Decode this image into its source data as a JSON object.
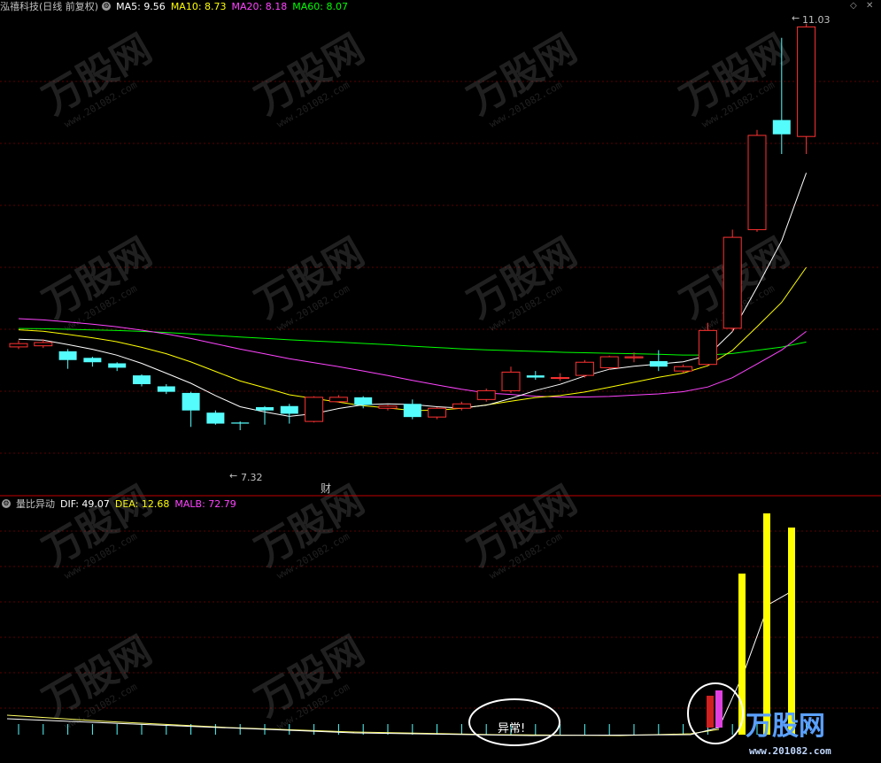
{
  "main_panel": {
    "title": "泓禧科技(日线 前复权)",
    "indicators": [
      {
        "label": "MA5",
        "value": "9.56",
        "color": "#ffffff"
      },
      {
        "label": "MA10",
        "value": "8.73",
        "color": "#ffff00"
      },
      {
        "label": "MA20",
        "value": "8.18",
        "color": "#ff44ff"
      },
      {
        "label": "MA60",
        "value": "8.07",
        "color": "#00ff00"
      }
    ],
    "high_label": "11.03",
    "low_label": "7.32",
    "finance_marker": "财",
    "corner_icons": [
      "diamond-icon",
      "close-icon"
    ]
  },
  "sub_panel": {
    "title": "量比异动",
    "indicators": [
      {
        "label": "DIF",
        "value": "49.07",
        "color": "#ffffff"
      },
      {
        "label": "DEA",
        "value": "12.68",
        "color": "#ffff00"
      },
      {
        "label": "MALB",
        "value": "72.79",
        "color": "#ff44ff"
      }
    ],
    "annotation": "异常!"
  },
  "watermark": {
    "brand": "万股网",
    "url": "www.201082.com"
  },
  "colors": {
    "up": "#ff3232",
    "down": "#54fcfc",
    "grid": "#5a0000",
    "divider": "#b00000"
  },
  "chart_data": {
    "type": "candlestick",
    "price_axis": [
      6.9,
      11.1
    ],
    "candles": [
      {
        "o": 8.08,
        "h": 8.14,
        "c": 8.11,
        "l": 8.06
      },
      {
        "o": 8.09,
        "h": 8.15,
        "c": 8.12,
        "l": 8.07
      },
      {
        "o": 8.04,
        "h": 8.06,
        "c": 7.96,
        "l": 7.88
      },
      {
        "o": 7.98,
        "h": 7.99,
        "c": 7.94,
        "l": 7.9
      },
      {
        "o": 7.93,
        "h": 7.94,
        "c": 7.89,
        "l": 7.86
      },
      {
        "o": 7.82,
        "h": 7.83,
        "c": 7.74,
        "l": 7.72
      },
      {
        "o": 7.72,
        "h": 7.74,
        "c": 7.67,
        "l": 7.65
      },
      {
        "o": 7.66,
        "h": 7.67,
        "c": 7.5,
        "l": 7.35
      },
      {
        "o": 7.48,
        "h": 7.5,
        "c": 7.38,
        "l": 7.37
      },
      {
        "o": 7.39,
        "h": 7.4,
        "c": 7.38,
        "l": 7.32
      },
      {
        "o": 7.53,
        "h": 7.54,
        "c": 7.5,
        "l": 7.37
      },
      {
        "o": 7.54,
        "h": 7.56,
        "c": 7.47,
        "l": 7.38
      },
      {
        "o": 7.4,
        "h": 7.63,
        "c": 7.62,
        "l": 7.39
      },
      {
        "o": 7.58,
        "h": 7.64,
        "c": 7.62,
        "l": 7.57
      },
      {
        "o": 7.62,
        "h": 7.63,
        "c": 7.55,
        "l": 7.52
      },
      {
        "o": 7.52,
        "h": 7.55,
        "c": 7.54,
        "l": 7.5
      },
      {
        "o": 7.56,
        "h": 7.6,
        "c": 7.44,
        "l": 7.42
      },
      {
        "o": 7.44,
        "h": 7.53,
        "c": 7.52,
        "l": 7.42
      },
      {
        "o": 7.52,
        "h": 7.58,
        "c": 7.56,
        "l": 7.5
      },
      {
        "o": 7.6,
        "h": 7.7,
        "c": 7.68,
        "l": 7.58
      },
      {
        "o": 7.68,
        "h": 7.9,
        "c": 7.85,
        "l": 7.66
      },
      {
        "o": 7.82,
        "h": 7.86,
        "c": 7.8,
        "l": 7.78
      },
      {
        "o": 7.8,
        "h": 7.84,
        "c": 7.8,
        "l": 7.77
      },
      {
        "o": 7.82,
        "h": 7.96,
        "c": 7.94,
        "l": 7.8
      },
      {
        "o": 7.89,
        "h": 8.0,
        "c": 7.99,
        "l": 7.87
      },
      {
        "o": 7.98,
        "h": 8.03,
        "c": 7.99,
        "l": 7.94
      },
      {
        "o": 7.95,
        "h": 8.05,
        "c": 7.9,
        "l": 7.86
      },
      {
        "o": 7.86,
        "h": 7.92,
        "c": 7.9,
        "l": 7.84
      },
      {
        "o": 7.92,
        "h": 8.3,
        "c": 8.23,
        "l": 7.91
      },
      {
        "o": 8.25,
        "h": 9.15,
        "c": 9.08,
        "l": 8.22
      },
      {
        "o": 9.15,
        "h": 10.06,
        "c": 10.01,
        "l": 9.13
      },
      {
        "o": 10.15,
        "h": 10.9,
        "c": 10.02,
        "l": 9.84
      },
      {
        "o": 10.0,
        "h": 11.03,
        "c": 11.0,
        "l": 9.84
      }
    ]
  }
}
